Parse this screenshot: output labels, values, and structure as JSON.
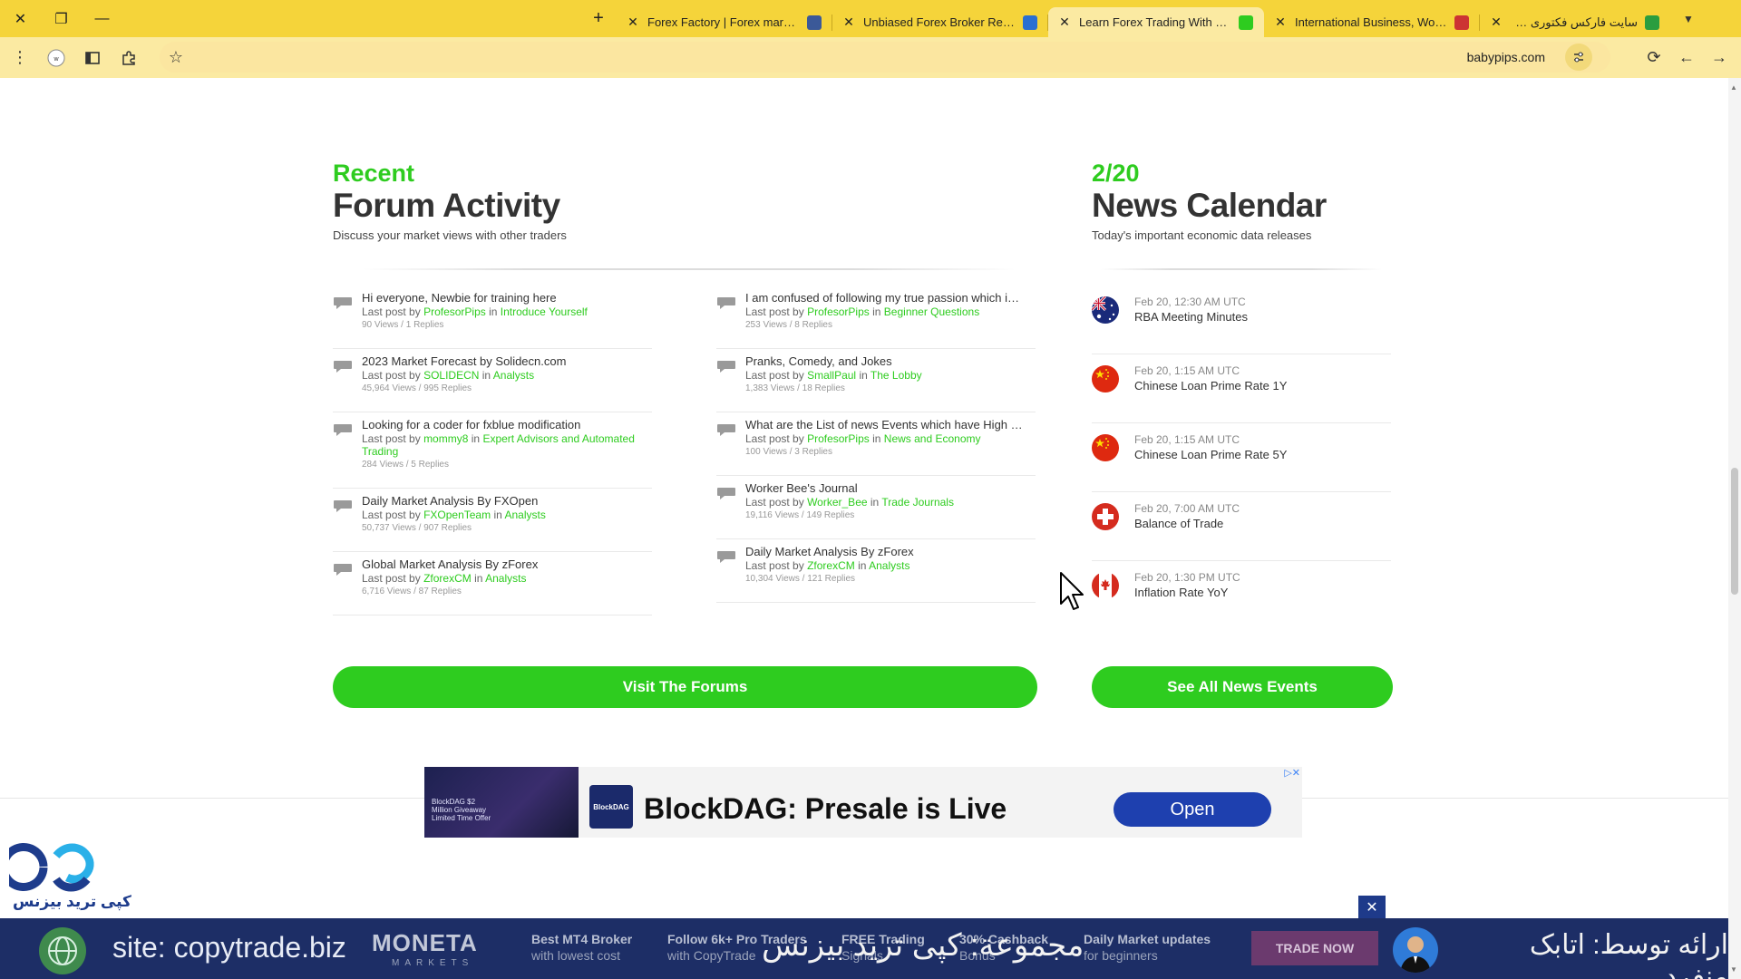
{
  "browser": {
    "tabs": [
      {
        "title": "Forex Factory | Forex markets fo",
        "favicon_color": "#3b5998",
        "active": false
      },
      {
        "title": "Unbiased Forex Broker Reviews",
        "favicon_color": "#2a6fd1",
        "active": false
      },
      {
        "title": "Learn Forex Trading With BabyPi",
        "favicon_color": "#2ecc1f",
        "active": true
      },
      {
        "title": "International Business, World N",
        "favicon_color": "#cc3333",
        "active": false
      },
      {
        "title": "سایت فارکس فکتوری چیست ؟",
        "favicon_color": "#2a9d3f",
        "active": false
      }
    ],
    "url": "babypips.com"
  },
  "forum": {
    "eyebrow": "Recent",
    "title": "Forum Activity",
    "subtitle": "Discuss your market views with other traders",
    "last_post_by": "Last post by",
    "in_word": "in",
    "button": "Visit The Forums",
    "columns": [
      [
        {
          "title": "Hi everyone, Newbie for training here",
          "user": "ProfesorPips",
          "category": "Introduce Yourself",
          "stats": "90 Views / 1 Replies"
        },
        {
          "title": "2023 Market Forecast by Solidecn.com",
          "user": "SOLIDECN",
          "category": "Analysts",
          "stats": "45,964 Views / 995 Replies"
        },
        {
          "title": "Looking for a coder for fxblue modification",
          "user": "mommy8",
          "category": "Expert Advisors and Automated Trading",
          "stats": "284 Views / 5 Replies"
        },
        {
          "title": "Daily Market Analysis By FXOpen",
          "user": "FXOpenTeam",
          "category": "Analysts",
          "stats": "50,737 Views / 907 Replies"
        },
        {
          "title": "Global Market Analysis By zForex",
          "user": "ZforexCM",
          "category": "Analysts",
          "stats": "6,716 Views / 87 Replies"
        }
      ],
      [
        {
          "title": "I am confused of following my true passion which i…",
          "user": "ProfesorPips",
          "category": "Beginner Questions",
          "stats": "253 Views / 8 Replies"
        },
        {
          "title": "Pranks, Comedy, and Jokes",
          "user": "SmallPaul",
          "category": "The Lobby",
          "stats": "1,383 Views / 18 Replies"
        },
        {
          "title": "What are the List of news Events which have High …",
          "user": "ProfesorPips",
          "category": "News and Economy",
          "stats": "100 Views / 3 Replies"
        },
        {
          "title": "Worker Bee's Journal",
          "user": "Worker_Bee",
          "category": "Trade Journals",
          "stats": "19,116 Views / 149 Replies"
        },
        {
          "title": "Daily Market Analysis By zForex",
          "user": "ZforexCM",
          "category": "Analysts",
          "stats": "10,304 Views / 121 Replies"
        }
      ]
    ]
  },
  "news": {
    "eyebrow": "2/20",
    "title": "News Calendar",
    "subtitle": "Today's important economic data releases",
    "button": "See All News Events",
    "items": [
      {
        "time": "Feb 20, 12:30 AM UTC",
        "name": "RBA Meeting Minutes",
        "flag": "australia-flag-icon"
      },
      {
        "time": "Feb 20, 1:15 AM UTC",
        "name": "Chinese Loan Prime Rate 1Y",
        "flag": "china-flag-icon"
      },
      {
        "time": "Feb 20, 1:15 AM UTC",
        "name": "Chinese Loan Prime Rate 5Y",
        "flag": "china-flag-icon"
      },
      {
        "time": "Feb 20, 7:00 AM UTC",
        "name": "Balance of Trade",
        "flag": "switzerland-flag-icon"
      },
      {
        "time": "Feb 20, 1:30 PM UTC",
        "name": "Inflation Rate YoY",
        "flag": "canada-flag-icon"
      }
    ]
  },
  "ad": {
    "image_text": "BlockDAG $2 Million Giveaway Limited Time Offer",
    "logo": "BlockDAG",
    "headline": "BlockDAG: Presale is Live",
    "cta": "Open"
  },
  "overlay": {
    "logo_text": "کپی ترید بیزنس",
    "site": "site: copytrade.biz",
    "moneta": "MONETA",
    "moneta_sub": "MARKETS",
    "promo1_a": "Best MT4 Broker",
    "promo1_b": "with lowest cost",
    "promo2_a": "Follow 6k+ Pro Traders",
    "promo2_b": "with CopyTrade",
    "promo3_a": "FREE Trading",
    "promo3_b": "Signals",
    "promo4_a": "30% Cashback",
    "promo4_b": "Bonus",
    "promo5_a": "Daily Market updates",
    "promo5_b": "for beginners",
    "persian_mid": "مجموعة: کپی ترید بیزنس",
    "trade_now": "TRADE NOW",
    "persian_right": "ارائه توسط: اتابک منفرد"
  },
  "colors": {
    "accent_green": "#2ecc1f",
    "chrome_yellow": "#f5d43a",
    "banner_navy": "#1d2e66"
  }
}
